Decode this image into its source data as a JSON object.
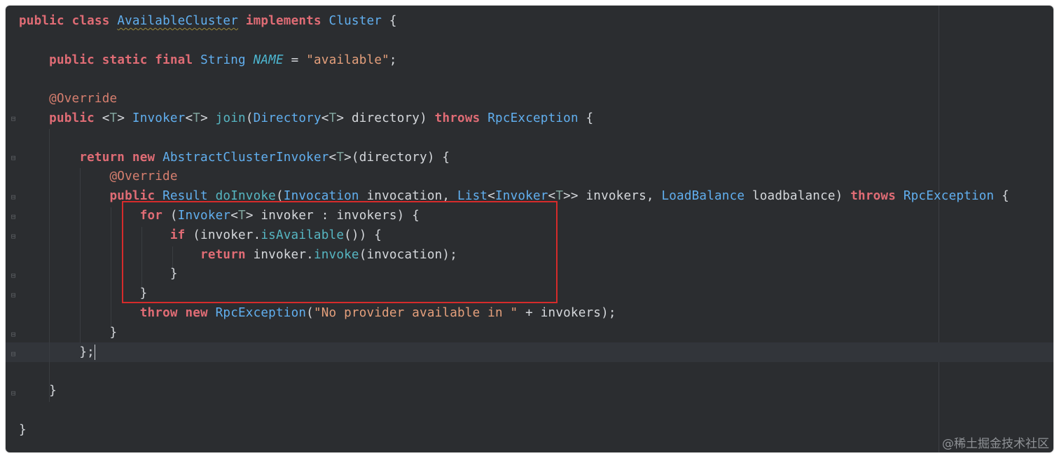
{
  "colors": {
    "background": "#2b2d30",
    "keyword": "#e06c75",
    "type": "#61afef",
    "method": "#56b6c2",
    "string": "#e5a07c",
    "annotation": "#d77f6f",
    "highlight_box": "#d62b2b"
  },
  "lines": [
    [
      {
        "t": "public",
        "c": "kw"
      },
      {
        "t": " "
      },
      {
        "t": "class",
        "c": "kw"
      },
      {
        "t": " "
      },
      {
        "t": "AvailableCluster",
        "c": "ty squig"
      },
      {
        "t": " "
      },
      {
        "t": "implements",
        "c": "kw"
      },
      {
        "t": " "
      },
      {
        "t": "Cluster",
        "c": "ty"
      },
      {
        "t": " {"
      }
    ],
    [],
    [
      {
        "t": "    "
      },
      {
        "t": "public",
        "c": "kw"
      },
      {
        "t": " "
      },
      {
        "t": "static",
        "c": "kw"
      },
      {
        "t": " "
      },
      {
        "t": "final",
        "c": "kw"
      },
      {
        "t": " "
      },
      {
        "t": "String",
        "c": "ty"
      },
      {
        "t": " "
      },
      {
        "t": "NAME",
        "c": "cst"
      },
      {
        "t": " = "
      },
      {
        "t": "\"available\"",
        "c": "st"
      },
      {
        "t": ";"
      }
    ],
    [],
    [
      {
        "t": "    "
      },
      {
        "t": "@Override",
        "c": "an"
      }
    ],
    [
      {
        "t": "    "
      },
      {
        "t": "public",
        "c": "kw"
      },
      {
        "t": " <"
      },
      {
        "t": "T",
        "c": "tp"
      },
      {
        "t": "> "
      },
      {
        "t": "Invoker",
        "c": "ty"
      },
      {
        "t": "<"
      },
      {
        "t": "T",
        "c": "tp"
      },
      {
        "t": "> "
      },
      {
        "t": "join",
        "c": "fn"
      },
      {
        "t": "("
      },
      {
        "t": "Directory",
        "c": "ty"
      },
      {
        "t": "<"
      },
      {
        "t": "T",
        "c": "tp"
      },
      {
        "t": "> directory) "
      },
      {
        "t": "throws",
        "c": "kw"
      },
      {
        "t": " "
      },
      {
        "t": "RpcException",
        "c": "ty"
      },
      {
        "t": " {"
      }
    ],
    [],
    [
      {
        "t": "        "
      },
      {
        "t": "return",
        "c": "kw"
      },
      {
        "t": " "
      },
      {
        "t": "new",
        "c": "kw"
      },
      {
        "t": " "
      },
      {
        "t": "AbstractClusterInvoker",
        "c": "ty"
      },
      {
        "t": "<"
      },
      {
        "t": "T",
        "c": "tp"
      },
      {
        "t": ">(directory) {"
      }
    ],
    [
      {
        "t": "            "
      },
      {
        "t": "@Override",
        "c": "an"
      }
    ],
    [
      {
        "t": "            "
      },
      {
        "t": "public",
        "c": "kw"
      },
      {
        "t": " "
      },
      {
        "t": "Result",
        "c": "ty"
      },
      {
        "t": " "
      },
      {
        "t": "doInvoke",
        "c": "fn"
      },
      {
        "t": "("
      },
      {
        "t": "Invocation",
        "c": "ty"
      },
      {
        "t": " invocation, "
      },
      {
        "t": "List",
        "c": "ty"
      },
      {
        "t": "<"
      },
      {
        "t": "Invoker",
        "c": "ty"
      },
      {
        "t": "<"
      },
      {
        "t": "T",
        "c": "tp"
      },
      {
        "t": ">> invokers, "
      },
      {
        "t": "LoadBalance",
        "c": "ty"
      },
      {
        "t": " loadbalance) "
      },
      {
        "t": "throws",
        "c": "kw"
      },
      {
        "t": " "
      },
      {
        "t": "RpcException",
        "c": "ty"
      },
      {
        "t": " {"
      }
    ],
    [
      {
        "t": "                "
      },
      {
        "t": "for",
        "c": "kw"
      },
      {
        "t": " ("
      },
      {
        "t": "Invoker",
        "c": "ty"
      },
      {
        "t": "<"
      },
      {
        "t": "T",
        "c": "tp"
      },
      {
        "t": "> invoker : invokers) {"
      }
    ],
    [
      {
        "t": "                    "
      },
      {
        "t": "if",
        "c": "kw"
      },
      {
        "t": " (invoker."
      },
      {
        "t": "isAvailable",
        "c": "fn"
      },
      {
        "t": "()) {"
      }
    ],
    [
      {
        "t": "                        "
      },
      {
        "t": "return",
        "c": "kw"
      },
      {
        "t": " invoker."
      },
      {
        "t": "invoke",
        "c": "fn"
      },
      {
        "t": "(invocation);"
      }
    ],
    [
      {
        "t": "                    }"
      }
    ],
    [
      {
        "t": "                }"
      }
    ],
    [
      {
        "t": "                "
      },
      {
        "t": "throw",
        "c": "kw"
      },
      {
        "t": " "
      },
      {
        "t": "new",
        "c": "kw"
      },
      {
        "t": " "
      },
      {
        "t": "RpcException",
        "c": "ty"
      },
      {
        "t": "("
      },
      {
        "t": "\"No provider available in \"",
        "c": "st"
      },
      {
        "t": " + invokers);"
      }
    ],
    [
      {
        "t": "            }"
      }
    ],
    [
      {
        "t": "        };"
      },
      {
        "cursor": true
      }
    ],
    [],
    [
      {
        "t": "    }"
      }
    ],
    [],
    [
      {
        "t": "}"
      }
    ]
  ],
  "watermark": "@稀土掘金技术社区"
}
